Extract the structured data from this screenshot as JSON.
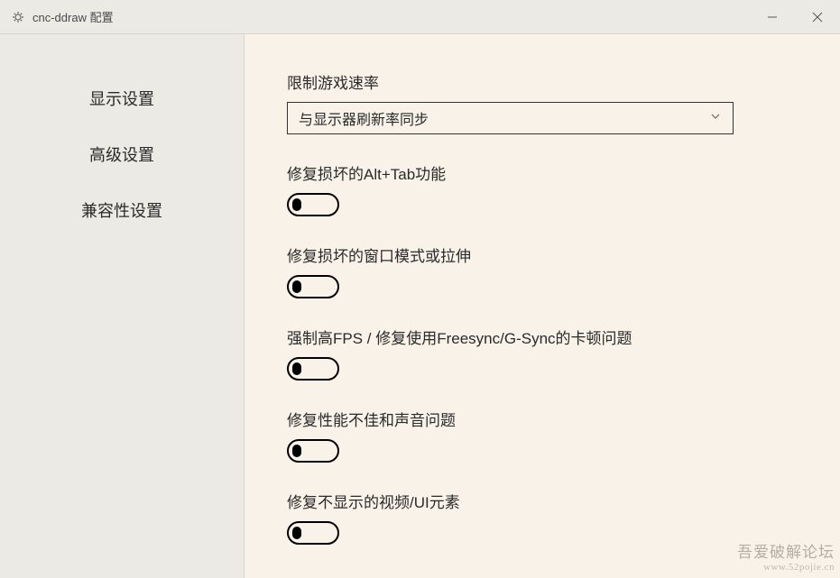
{
  "window": {
    "title": "cnc-ddraw 配置"
  },
  "sidebar": {
    "items": [
      {
        "label": "显示设置"
      },
      {
        "label": "高级设置"
      },
      {
        "label": "兼容性设置"
      }
    ]
  },
  "settings": {
    "limit_speed": {
      "label": "限制游戏速率",
      "selected": "与显示器刷新率同步"
    },
    "fix_alttab": {
      "label": "修复损坏的Alt+Tab功能",
      "value": false
    },
    "fix_window": {
      "label": "修复损坏的窗口模式或拉伸",
      "value": false
    },
    "force_fps": {
      "label": "强制高FPS / 修复使用Freesync/G-Sync的卡顿问题",
      "value": false
    },
    "fix_perf": {
      "label": "修复性能不佳和声音问题",
      "value": false
    },
    "fix_ui": {
      "label": "修复不显示的视频/UI元素",
      "value": false
    }
  },
  "watermark": {
    "main": "吾爱破解论坛",
    "sub": "www.52pojie.cn"
  }
}
